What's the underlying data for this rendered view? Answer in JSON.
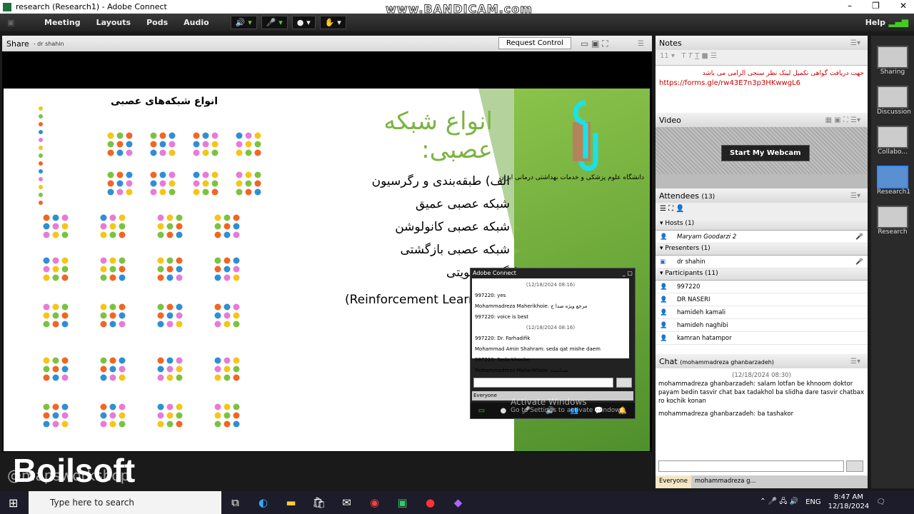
{
  "window": {
    "title": "research (Research1) - Adobe Connect",
    "watermark": "www.BANDICAM.com"
  },
  "menu": {
    "items": [
      "Meeting",
      "Layouts",
      "Pods",
      "Audio"
    ],
    "help": "Help"
  },
  "share": {
    "title": "Share",
    "presenter": "- dr shahin",
    "request_control": "Request Control"
  },
  "slide": {
    "title": "انواع شبکه عصبی:",
    "zoo_title": "انواع شبکه‌های عصبی",
    "university": "دانشگاه علوم پزشکی و خدمات بهداشتی درمانی ایران",
    "bullets": [
      "الف) طبقه‌بندی و رگرسیون",
      "شبکه عصبی عمیق",
      "شبکه عصبی کانولوشن",
      "شبکه عصبی بازگشتی",
      "یادگیری تقویتی"
    ],
    "reinforcement": "(Reinforcement Learning)"
  },
  "popup": {
    "title": "Adobe Connect",
    "messages": [
      {
        "date": "(12/18/2024 08:16)"
      },
      {
        "text": "997220: yes"
      },
      {
        "text": "Mohammadreza Maherikhoie: مرجع ویژه صدا ج"
      },
      {
        "text": "997220: voice  is best"
      },
      {
        "date": "(12/18/2024 08:16)"
      },
      {
        "text": "997220: Dr. Farhadifik"
      },
      {
        "text": "Mohammad Amin Shahram: seda qat mishe daem"
      },
      {
        "text": "997220: Seda khoobe"
      },
      {
        "text": "Mohammadreza Maherikhoie: صداست"
      }
    ],
    "everyone": "Everyone"
  },
  "activate": {
    "title": "Activate Windows",
    "sub": "Go to Settings to activate Windows."
  },
  "notes": {
    "title": "Notes",
    "font_size": "11",
    "text_fa": "جهت دریافت گواهی تکمیل لینک نظر سنجی الزامی می باشد",
    "link": "https://forms.gle/rw43E7n3p3HKwwgL6"
  },
  "video": {
    "title": "Video",
    "start_webcam": "Start My Webcam"
  },
  "attendees": {
    "title": "Attendees",
    "count": "(13)",
    "groups": [
      {
        "label": "Hosts (1)",
        "people": [
          "Maryam Goodarzi 2"
        ]
      },
      {
        "label": "Presenters (1)",
        "people": [
          "dr shahin"
        ]
      },
      {
        "label": "Participants (11)",
        "people": [
          "997220",
          "DR NASERI",
          "hamideh kamali",
          "hamideh naghibi",
          "kamran hatampor"
        ]
      }
    ]
  },
  "chat": {
    "title": "Chat",
    "subtitle": "(mohammadreza ghanbarzadeh)",
    "date": "(12/18/2024 08:30)",
    "messages": [
      "mohammadreza ghanbarzadeh: salam lotfan be khnoom doktor payam bedin tasvir chat bax tadakhol ba slidha dare tasvir chatbax ro kochik konan",
      "mohammadreza ghanbarzadeh: ba tashakor"
    ],
    "tabs": [
      "Everyone",
      "mohammadreza g..."
    ]
  },
  "layouts": [
    "Sharing",
    "Discussion",
    "Collabo...",
    "Research1",
    "Research"
  ],
  "overlay": {
    "boilsoft": "Boilsoft",
    "workshop": "@mapsworkshop"
  },
  "taskbar": {
    "search": "Type here to search",
    "lang": "ENG",
    "time": "8:47 AM",
    "date": "12/18/2024"
  }
}
